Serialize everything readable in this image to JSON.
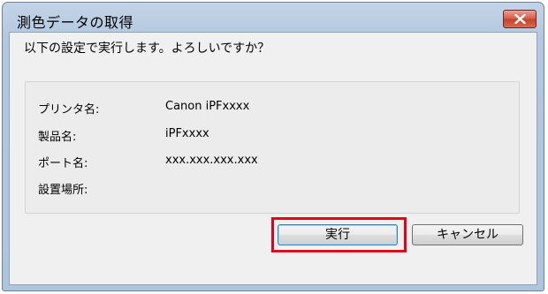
{
  "window": {
    "title": "測色データの取得"
  },
  "dialog": {
    "question": "以下の設定で実行します。よろしいですか？"
  },
  "info": {
    "rows": [
      {
        "label": "プリンタ名:",
        "value": "Canon iPFxxxx"
      },
      {
        "label": "製品名:",
        "value": "iPFxxxx"
      },
      {
        "label": "ポート名:",
        "value": "xxx.xxx.xxx.xxx"
      },
      {
        "label": "設置場所:",
        "value": ""
      }
    ]
  },
  "buttons": {
    "execute_label": "実行",
    "cancel_label": "キャンセル"
  },
  "colors": {
    "highlight": "#e3001b",
    "close_button": "#c8412b"
  },
  "icons": {
    "close": "close-icon"
  }
}
